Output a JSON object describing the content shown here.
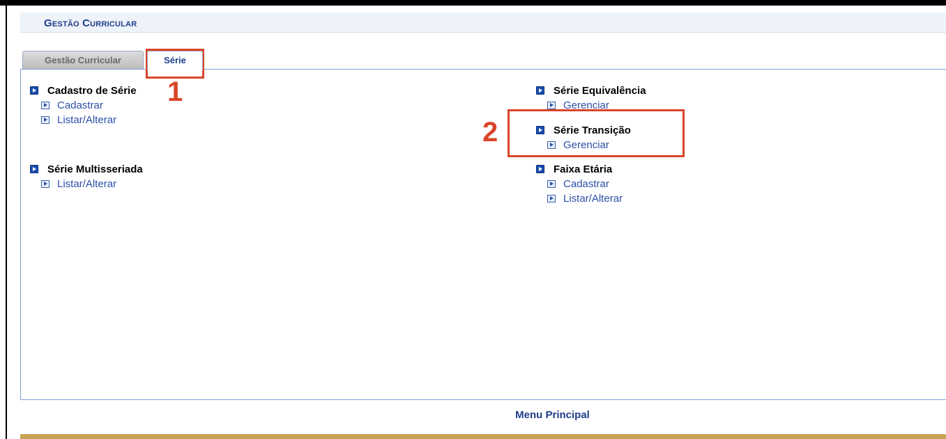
{
  "header": {
    "title": "Gestão Curricular"
  },
  "tabs": [
    {
      "label": "Gestão Curricular",
      "active": false
    },
    {
      "label": "Série",
      "active": true
    }
  ],
  "groups": {
    "cadastro_serie": {
      "title": "Cadastro de Série",
      "links": [
        "Cadastrar",
        "Listar/Alterar"
      ]
    },
    "serie_multisseriada": {
      "title": "Série Multisseriada",
      "links": [
        "Listar/Alterar"
      ]
    },
    "serie_equivalencia": {
      "title": "Série Equivalência",
      "links": [
        "Gerenciar"
      ]
    },
    "serie_transicao": {
      "title": "Série Transição",
      "links": [
        "Gerenciar"
      ]
    },
    "faixa_etaria": {
      "title": "Faixa Etária",
      "links": [
        "Cadastrar",
        "Listar/Alterar"
      ]
    }
  },
  "annotations": {
    "step1": "1",
    "step2": "2",
    "color": "#d9452a"
  },
  "footer": {
    "menu_principal": "Menu Principal"
  },
  "colors": {
    "accent": "#1e3d8a",
    "link": "#2e4fa8",
    "panel_border": "#7d9fd4",
    "footer_bar": "#c9a355"
  }
}
